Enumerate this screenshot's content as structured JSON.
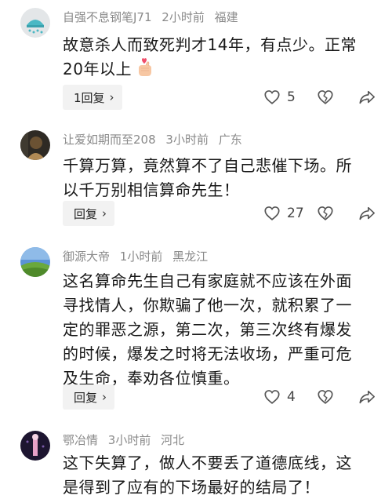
{
  "comments": [
    {
      "username": "自强不息钢笔J71",
      "time": "2小时前",
      "location": "福建",
      "lines": [
        "故意杀人而致死判才14年，有点少。正常",
        "20年以上"
      ],
      "emoji": "finger-heart-emoji",
      "reply_label": "1回复",
      "likes": "5",
      "avatar_colors": {
        "bg": "#e3e6e8",
        "accent": "#4bb8c4"
      }
    },
    {
      "username": "让爱如期而至208",
      "time": "3小时前",
      "location": "广东",
      "lines": [
        "千算万算，竟然算不了自己悲催下场。所",
        "以千万别相信算命先生！"
      ],
      "reply_label": "回复",
      "likes": "27",
      "avatar_colors": {
        "bg": "#2e2a24",
        "accent": "#b08a55"
      }
    },
    {
      "username": "御源大帝",
      "time": "1小时前",
      "location": "黑龙江",
      "lines": [
        "这名算命先生自己有家庭就不应该在外面",
        "寻找情人，你欺骗了他一次，就积累了一",
        "定的罪恶之源，第二次，第三次终有爆发",
        "的时候，爆发之时将无法收场，严重可危",
        "及生命，奉劝各位慎重。"
      ],
      "reply_label": "回复",
      "likes": "4",
      "avatar_colors": {
        "bg": "#5b93d6",
        "accent": "#6aa83c"
      }
    },
    {
      "username": "鄂冶情",
      "time": "3小时前",
      "location": "河北",
      "lines": [
        "这下失算了，做人不要丢了道德底线，这",
        "是得到了应有的下场最好的结局了！"
      ],
      "avatar_colors": {
        "bg": "#1d1530",
        "accent": "#e8a0c8"
      }
    }
  ]
}
